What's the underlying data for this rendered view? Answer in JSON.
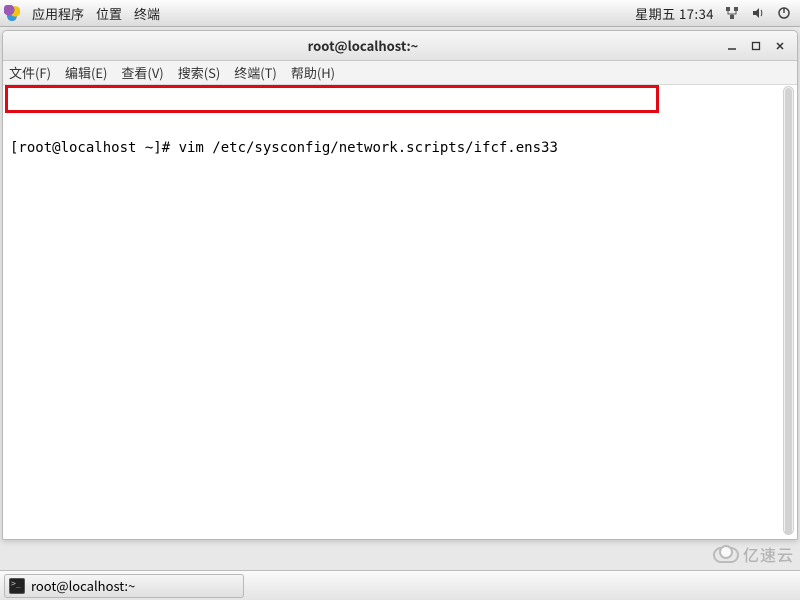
{
  "panel": {
    "applications": "应用程序",
    "places": "位置",
    "terminal": "终端",
    "clock": "星期五 17:34"
  },
  "window": {
    "title": "root@localhost:~",
    "menubar": {
      "file": "文件(F)",
      "edit": "编辑(E)",
      "view": "查看(V)",
      "search": "搜索(S)",
      "terminal": "终端(T)",
      "help": "帮助(H)"
    },
    "prompt": "[root@localhost ~]# ",
    "command": "vim /etc/sysconfig/network.scripts/ifcf.ens33"
  },
  "taskbar": {
    "task1": "root@localhost:~"
  },
  "watermark": "亿速云"
}
